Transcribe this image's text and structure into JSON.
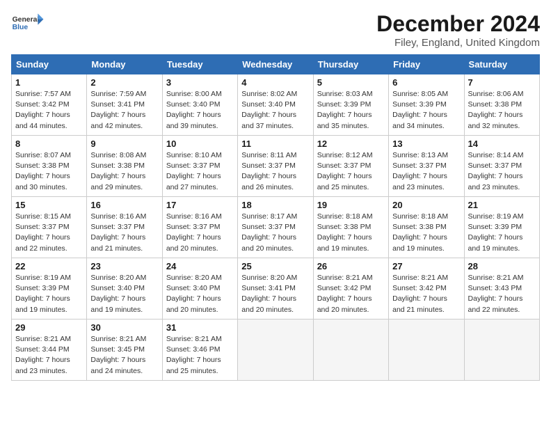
{
  "header": {
    "logo_general": "General",
    "logo_blue": "Blue",
    "month_title": "December 2024",
    "location": "Filey, England, United Kingdom"
  },
  "weekdays": [
    "Sunday",
    "Monday",
    "Tuesday",
    "Wednesday",
    "Thursday",
    "Friday",
    "Saturday"
  ],
  "weeks": [
    [
      {
        "day": 1,
        "sunrise": "7:57 AM",
        "sunset": "3:42 PM",
        "daylight": "7 hours and 44 minutes."
      },
      {
        "day": 2,
        "sunrise": "7:59 AM",
        "sunset": "3:41 PM",
        "daylight": "7 hours and 42 minutes."
      },
      {
        "day": 3,
        "sunrise": "8:00 AM",
        "sunset": "3:40 PM",
        "daylight": "7 hours and 39 minutes."
      },
      {
        "day": 4,
        "sunrise": "8:02 AM",
        "sunset": "3:40 PM",
        "daylight": "7 hours and 37 minutes."
      },
      {
        "day": 5,
        "sunrise": "8:03 AM",
        "sunset": "3:39 PM",
        "daylight": "7 hours and 35 minutes."
      },
      {
        "day": 6,
        "sunrise": "8:05 AM",
        "sunset": "3:39 PM",
        "daylight": "7 hours and 34 minutes."
      },
      {
        "day": 7,
        "sunrise": "8:06 AM",
        "sunset": "3:38 PM",
        "daylight": "7 hours and 32 minutes."
      }
    ],
    [
      {
        "day": 8,
        "sunrise": "8:07 AM",
        "sunset": "3:38 PM",
        "daylight": "7 hours and 30 minutes."
      },
      {
        "day": 9,
        "sunrise": "8:08 AM",
        "sunset": "3:38 PM",
        "daylight": "7 hours and 29 minutes."
      },
      {
        "day": 10,
        "sunrise": "8:10 AM",
        "sunset": "3:37 PM",
        "daylight": "7 hours and 27 minutes."
      },
      {
        "day": 11,
        "sunrise": "8:11 AM",
        "sunset": "3:37 PM",
        "daylight": "7 hours and 26 minutes."
      },
      {
        "day": 12,
        "sunrise": "8:12 AM",
        "sunset": "3:37 PM",
        "daylight": "7 hours and 25 minutes."
      },
      {
        "day": 13,
        "sunrise": "8:13 AM",
        "sunset": "3:37 PM",
        "daylight": "7 hours and 23 minutes."
      },
      {
        "day": 14,
        "sunrise": "8:14 AM",
        "sunset": "3:37 PM",
        "daylight": "7 hours and 23 minutes."
      }
    ],
    [
      {
        "day": 15,
        "sunrise": "8:15 AM",
        "sunset": "3:37 PM",
        "daylight": "7 hours and 22 minutes."
      },
      {
        "day": 16,
        "sunrise": "8:16 AM",
        "sunset": "3:37 PM",
        "daylight": "7 hours and 21 minutes."
      },
      {
        "day": 17,
        "sunrise": "8:16 AM",
        "sunset": "3:37 PM",
        "daylight": "7 hours and 20 minutes."
      },
      {
        "day": 18,
        "sunrise": "8:17 AM",
        "sunset": "3:37 PM",
        "daylight": "7 hours and 20 minutes."
      },
      {
        "day": 19,
        "sunrise": "8:18 AM",
        "sunset": "3:38 PM",
        "daylight": "7 hours and 19 minutes."
      },
      {
        "day": 20,
        "sunrise": "8:18 AM",
        "sunset": "3:38 PM",
        "daylight": "7 hours and 19 minutes."
      },
      {
        "day": 21,
        "sunrise": "8:19 AM",
        "sunset": "3:39 PM",
        "daylight": "7 hours and 19 minutes."
      }
    ],
    [
      {
        "day": 22,
        "sunrise": "8:19 AM",
        "sunset": "3:39 PM",
        "daylight": "7 hours and 19 minutes."
      },
      {
        "day": 23,
        "sunrise": "8:20 AM",
        "sunset": "3:40 PM",
        "daylight": "7 hours and 19 minutes."
      },
      {
        "day": 24,
        "sunrise": "8:20 AM",
        "sunset": "3:40 PM",
        "daylight": "7 hours and 20 minutes."
      },
      {
        "day": 25,
        "sunrise": "8:20 AM",
        "sunset": "3:41 PM",
        "daylight": "7 hours and 20 minutes."
      },
      {
        "day": 26,
        "sunrise": "8:21 AM",
        "sunset": "3:42 PM",
        "daylight": "7 hours and 20 minutes."
      },
      {
        "day": 27,
        "sunrise": "8:21 AM",
        "sunset": "3:42 PM",
        "daylight": "7 hours and 21 minutes."
      },
      {
        "day": 28,
        "sunrise": "8:21 AM",
        "sunset": "3:43 PM",
        "daylight": "7 hours and 22 minutes."
      }
    ],
    [
      {
        "day": 29,
        "sunrise": "8:21 AM",
        "sunset": "3:44 PM",
        "daylight": "7 hours and 23 minutes."
      },
      {
        "day": 30,
        "sunrise": "8:21 AM",
        "sunset": "3:45 PM",
        "daylight": "7 hours and 24 minutes."
      },
      {
        "day": 31,
        "sunrise": "8:21 AM",
        "sunset": "3:46 PM",
        "daylight": "7 hours and 25 minutes."
      },
      null,
      null,
      null,
      null
    ]
  ]
}
